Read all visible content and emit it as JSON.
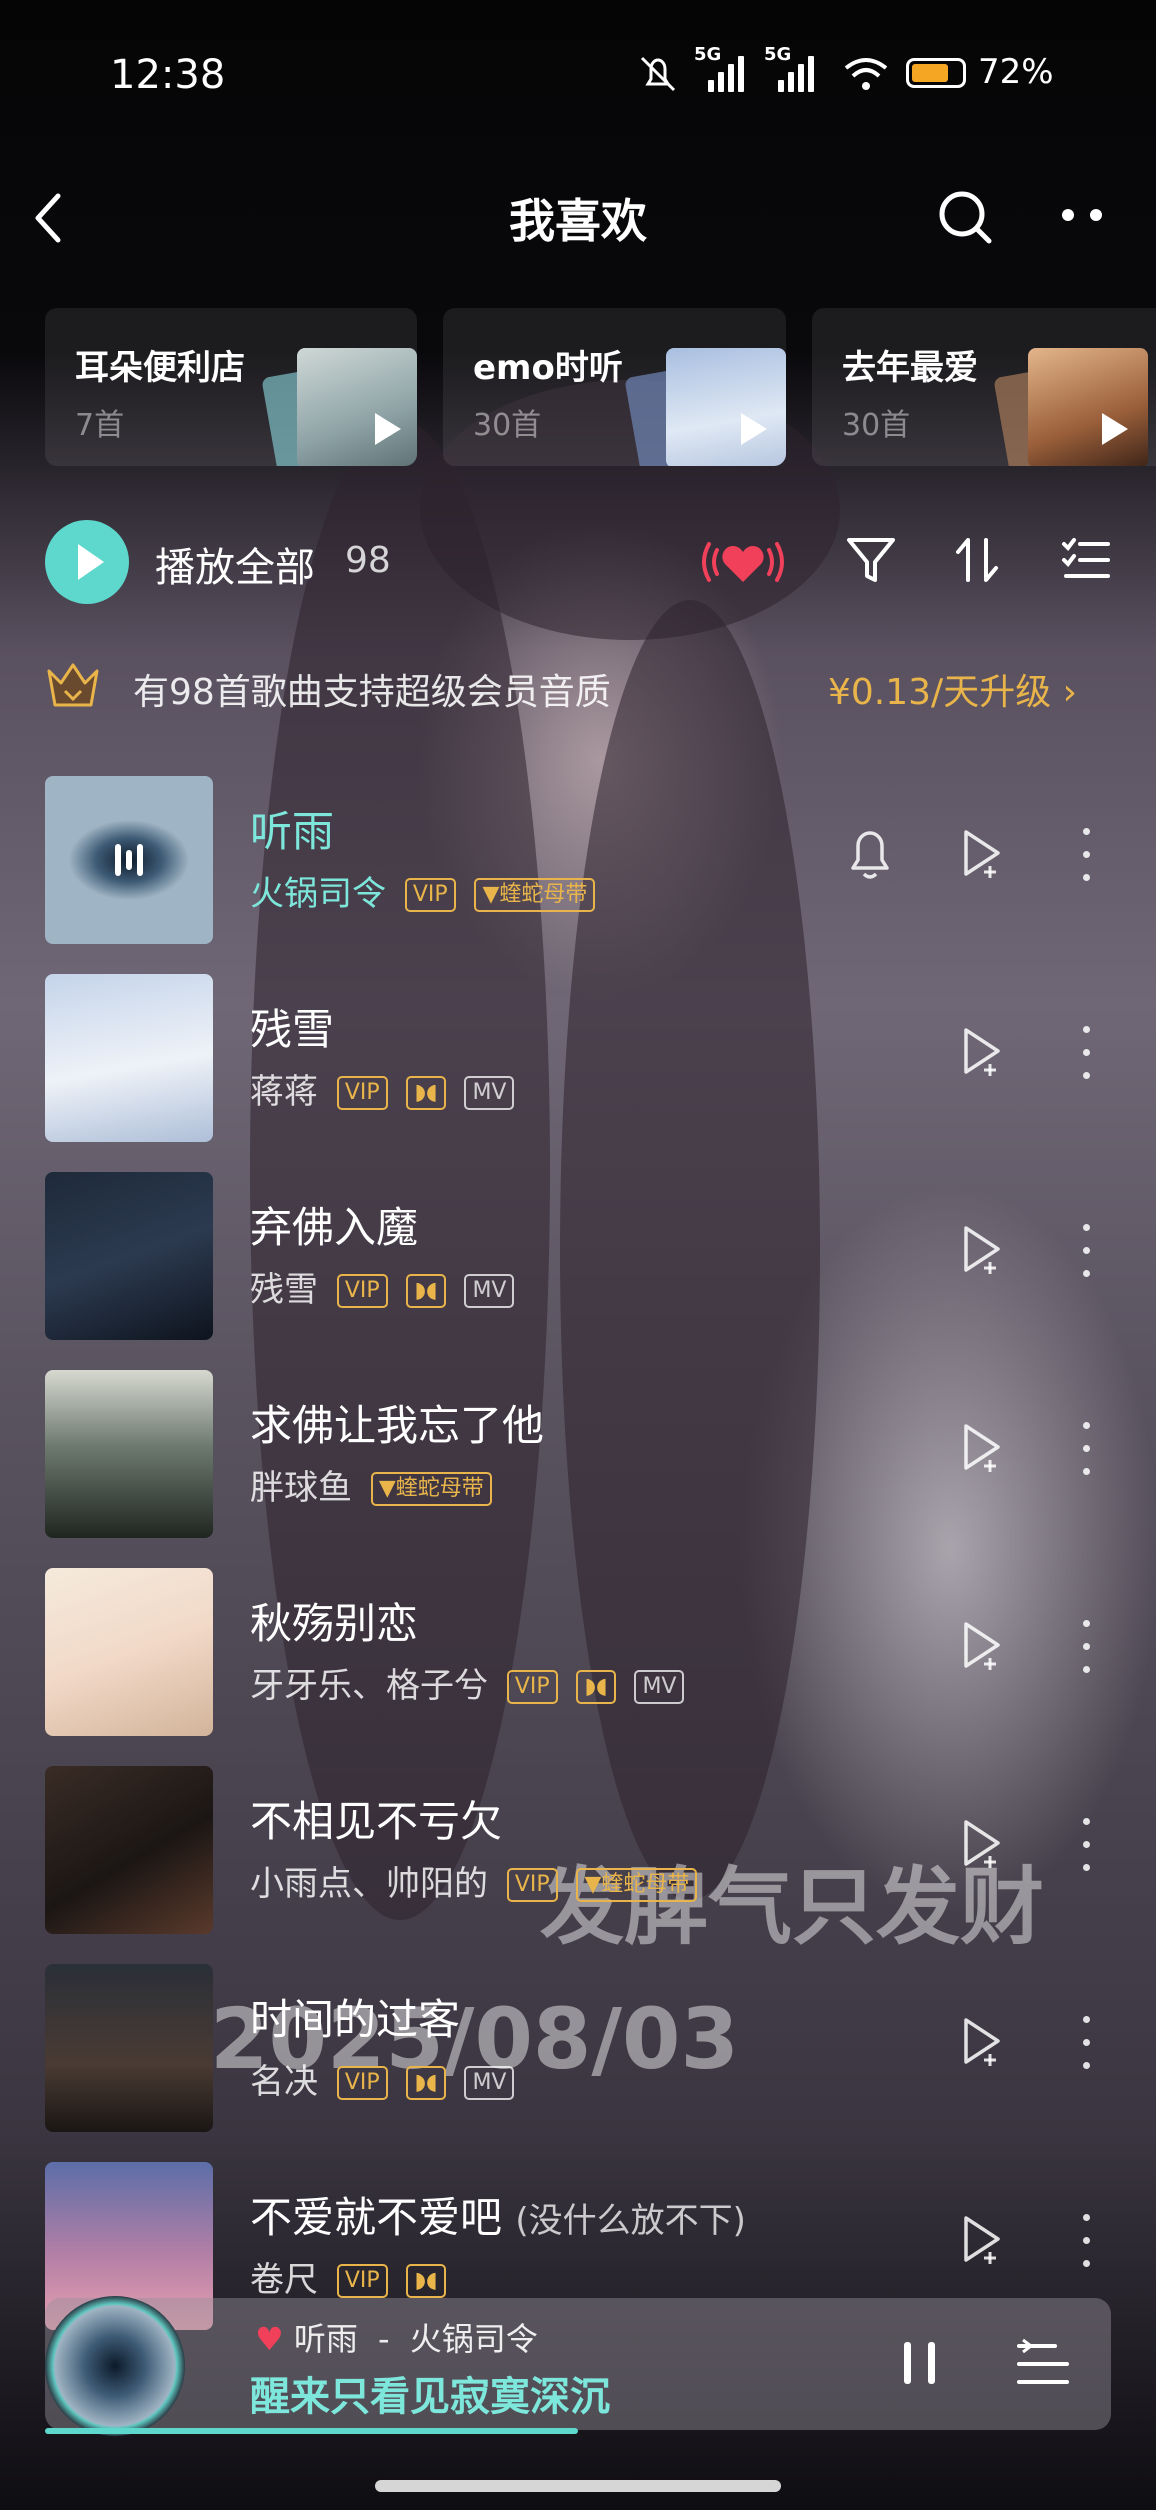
{
  "status_bar": {
    "time": "12:38",
    "net1": "5G",
    "net2": "5G",
    "battery": "72%"
  },
  "header": {
    "title": "我喜欢"
  },
  "playlists": [
    {
      "name": "耳朵便利店",
      "count": "7首"
    },
    {
      "name": "emo时听",
      "count": "30首"
    },
    {
      "name": "去年最爱",
      "count": "30首"
    }
  ],
  "controls": {
    "play_all": "播放全部",
    "count": "98"
  },
  "vip_banner": {
    "text": "有98首歌曲支持超级会员音质",
    "upgrade": "¥0.13/天升级 ›"
  },
  "tags": {
    "vip": "VIP",
    "mv": "MV",
    "dolby": "◗◖",
    "album": "▼蝰蛇母带"
  },
  "songs": [
    {
      "title": "听雨",
      "artist": "火锅司令"
    },
    {
      "title": "残雪",
      "artist": "蒋蒋"
    },
    {
      "title": "弃佛入魔",
      "artist": "残雪"
    },
    {
      "title": "求佛让我忘了他",
      "artist": "胖球鱼"
    },
    {
      "title": "秋殇别恋",
      "artist": "牙牙乐、格子兮"
    },
    {
      "title": "不相见不亏欠",
      "artist": "小雨点、帅阳的"
    },
    {
      "title": "时间的过客",
      "artist": "名决"
    },
    {
      "title": "不爱就不爱吧",
      "subtitle": "(没什么放不下)",
      "artist": "卷尺"
    }
  ],
  "watermark": {
    "line1": "发脾气只发财",
    "line2": "2025/08/03"
  },
  "mini_player": {
    "song": "听雨",
    "sep": "-",
    "artist": "火锅司令",
    "lyric": "醒来只看见寂寞深沉",
    "progress": 0.5
  },
  "colors": {
    "accent": "#5ed7cc",
    "vip_gold": "#e9b54a",
    "heart": "#f0405a"
  }
}
